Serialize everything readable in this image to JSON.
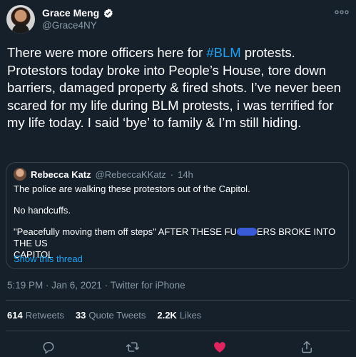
{
  "author": {
    "name": "Grace Meng",
    "handle": "@Grace4NY"
  },
  "tweet": {
    "text_before": "There were more officers here for ",
    "hashtag": "#BLM",
    "text_after": " protests. Protestors today broke into People’s House, tore down barriers, damaged property & fired shots. I’ve never been scared for my life during BLM protests, i was terrified for my life today. I said ‘bye’ to family & I’m still hiding."
  },
  "quote": {
    "name": "Rebecca Katz",
    "handle": "@RebeccaKKatz",
    "separator": "·",
    "time": "14h",
    "line1": "The police are walking these protestors out of the Capitol.",
    "line2": "No handcuffs.",
    "line3_before": "\"Peacefully moving them off steps\" AFTER THESE FU",
    "line3_after": "ERS BROKE INTO THE US",
    "line3_end": "CAPITOL",
    "show_thread": "Show this thread"
  },
  "meta": "5:19 PM · Jan 6, 2021 · Twitter for iPhone",
  "stats": {
    "retweets_count": "614",
    "retweets_label": "Retweets",
    "quotes_count": "33",
    "quotes_label": "Quote Tweets",
    "likes_count": "2.2K",
    "likes_label": "Likes"
  },
  "colors": {
    "background": "#15202b",
    "text": "#ffffff",
    "secondary": "#8899a6",
    "link": "#1da1f2",
    "border": "#38444d",
    "liked": "#e0245e"
  },
  "icons": [
    "verified-badge-icon",
    "more-icon",
    "reply-icon",
    "retweet-icon",
    "like-icon",
    "share-icon"
  ]
}
